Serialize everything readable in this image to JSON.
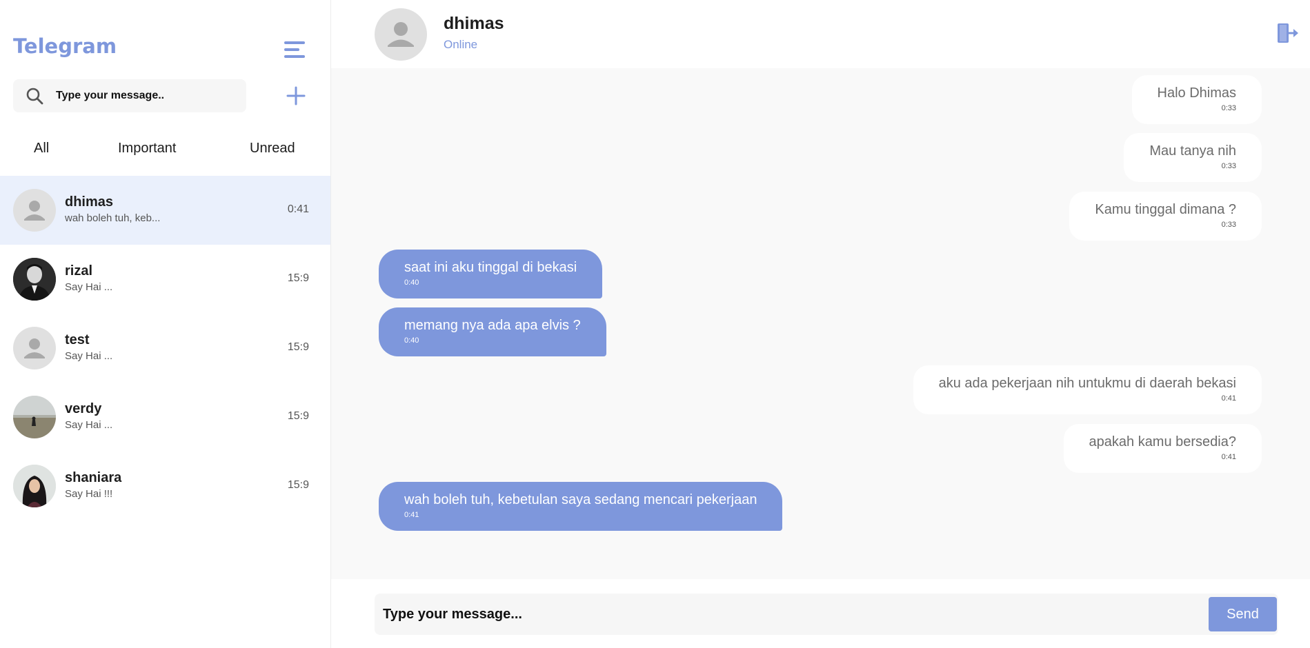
{
  "app": {
    "title": "Telegram"
  },
  "sidebar": {
    "search_placeholder": "Type your message..",
    "tabs": [
      {
        "label": "All"
      },
      {
        "label": "Important"
      },
      {
        "label": "Unread"
      }
    ],
    "chats": [
      {
        "name": "dhimas",
        "preview": "wah boleh tuh, keb...",
        "time": "0:41",
        "active": true,
        "avatar": "default-avatar"
      },
      {
        "name": "rizal",
        "preview": "Say Hai ...",
        "time": "15:9",
        "active": false,
        "avatar": "photo"
      },
      {
        "name": "test",
        "preview": "Say Hai ...",
        "time": "15:9",
        "active": false,
        "avatar": "default-avatar"
      },
      {
        "name": "verdy",
        "preview": "Say Hai ...",
        "time": "15:9",
        "active": false,
        "avatar": "photo"
      },
      {
        "name": "shaniara",
        "preview": "Say Hai !!!",
        "time": "15:9",
        "active": false,
        "avatar": "photo"
      }
    ]
  },
  "header": {
    "name": "dhimas",
    "status": "Online"
  },
  "messages": [
    {
      "text": "Halo Dhimas",
      "time": "0:33",
      "direction": "in"
    },
    {
      "text": "Mau tanya nih",
      "time": "0:33",
      "direction": "in"
    },
    {
      "text": "Kamu tinggal dimana ?",
      "time": "0:33",
      "direction": "in"
    },
    {
      "text": "saat ini aku tinggal di bekasi",
      "time": "0:40",
      "direction": "out"
    },
    {
      "text": "memang nya ada apa elvis ?",
      "time": "0:40",
      "direction": "out"
    },
    {
      "text": "aku ada pekerjaan nih untukmu di daerah bekasi",
      "time": "0:41",
      "direction": "in"
    },
    {
      "text": "apakah kamu bersedia?",
      "time": "0:41",
      "direction": "in"
    },
    {
      "text": "wah boleh tuh, kebetulan saya sedang mencari pekerjaan",
      "time": "0:41",
      "direction": "out"
    }
  ],
  "composer": {
    "placeholder": "Type your message...",
    "send_label": "Send"
  },
  "colors": {
    "accent": "#7e97dc",
    "active_bg": "#eaf0fc",
    "chat_bg": "#f9f9f9"
  }
}
